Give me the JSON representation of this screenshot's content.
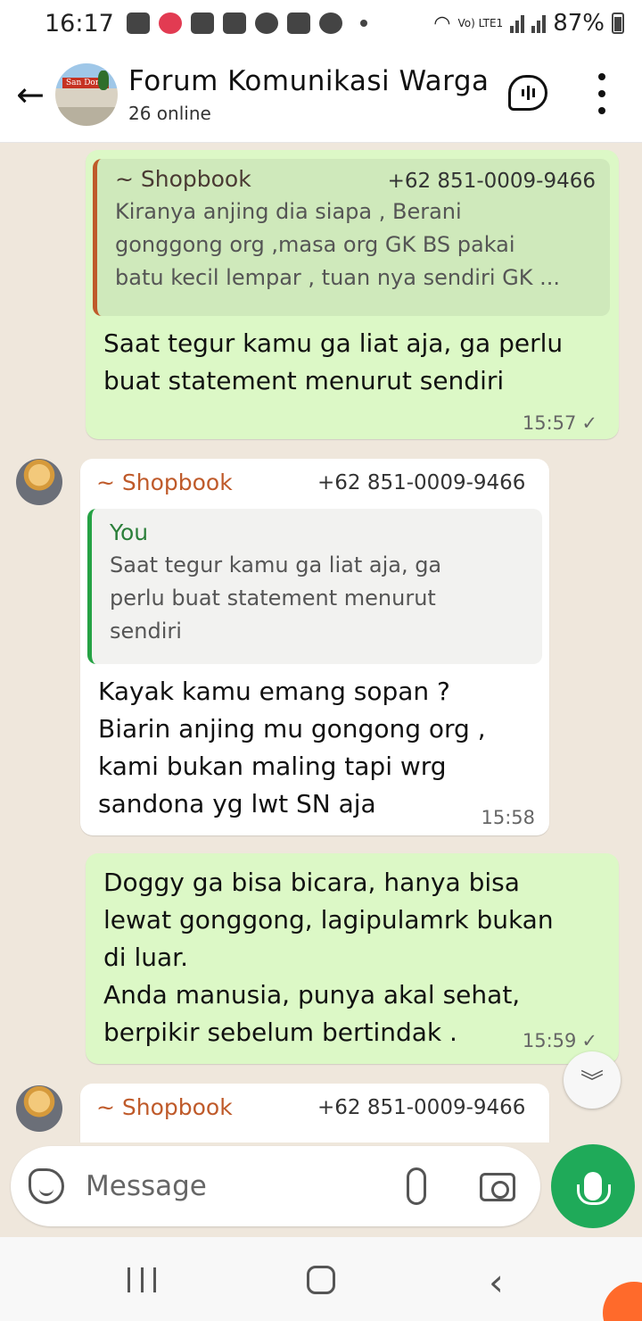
{
  "status_bar": {
    "time": "16:17",
    "lte_label": "Vo) LTE1",
    "battery": "87%"
  },
  "header": {
    "title": "Forum Komunikasi Warga",
    "subtitle": "26 online",
    "avatar_sign": "San Dona"
  },
  "messages": [
    {
      "direction": "out",
      "quote": {
        "author": "~ Shopbook",
        "phone": "+62 851-0009-9466",
        "lines": [
          "Kiranya anjing dia siapa , Berani",
          "gonggong org ,masa org GK BS pakai",
          "batu kecil lempar , tuan nya sendiri GK ..."
        ]
      },
      "lines": [
        "Saat tegur kamu ga liat aja, ga perlu",
        "buat statement menurut sendiri"
      ],
      "time": "15:57"
    },
    {
      "direction": "in",
      "sender": "~ Shopbook",
      "phone": "+62 851-0009-9466",
      "quote": {
        "author": "You",
        "lines": [
          "Saat tegur kamu ga liat aja, ga",
          "perlu buat statement menurut",
          "sendiri"
        ]
      },
      "lines": [
        "Kayak kamu emang sopan ?",
        "Biarin anjing mu gongong org ,",
        "kami bukan maling tapi wrg",
        "sandona yg lwt SN aja"
      ],
      "time": "15:58"
    },
    {
      "direction": "out",
      "lines": [
        "Doggy ga bisa bicara, hanya bisa",
        "lewat gonggong, lagipulamrk bukan",
        "di luar.",
        "Anda manusia, punya akal sehat,",
        "berpikir sebelum bertindak ."
      ],
      "time": "15:59"
    },
    {
      "direction": "in",
      "sender": "~ Shopbook",
      "phone": "+62 851-0009-9466"
    }
  ],
  "composer": {
    "placeholder": "Message"
  },
  "colors": {
    "outgoing_bubble": "#dcf8c6",
    "incoming_bubble": "#ffffff",
    "accent_green": "#1faa59",
    "sender_name": "#bf5a2a"
  },
  "icons": {
    "tick": "✓",
    "scroll_down": "chevron-double-down-icon"
  }
}
